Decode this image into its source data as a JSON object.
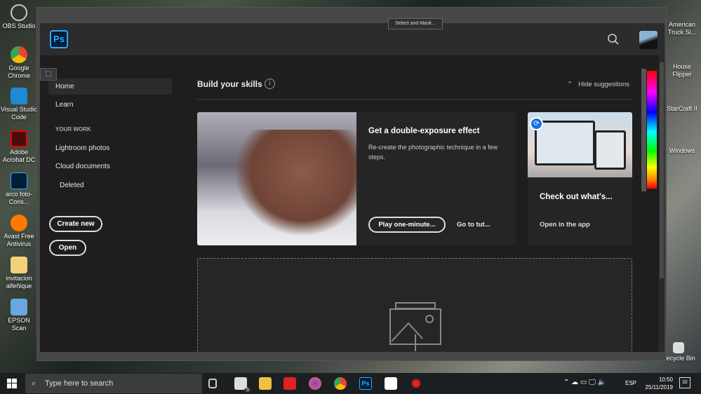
{
  "desktop": {
    "left_icons": [
      "OBS Studio",
      "Google Chrome",
      "Visual Studio Code",
      "Adobe Acrobat DC",
      "arco foto-Cons...",
      "Avast Free Antivirus",
      "invitacion alfeñique",
      "EPSON Scan"
    ],
    "right_icons": [
      "American Truck Si...",
      "House Flipper",
      "StarCraft II",
      "Windows"
    ],
    "recycle_bin": "Recycle Bin"
  },
  "app": {
    "logo": "Ps",
    "select_and_mask": "Select and Mask...",
    "marquee_icon": "⬚",
    "sidebar": {
      "home": "Home",
      "learn": "Learn",
      "section": "YOUR WORK",
      "lightroom": "Lightroom photos",
      "cloud": "Cloud documents",
      "deleted": "Deleted",
      "create_new": "Create new",
      "open": "Open"
    },
    "main": {
      "title": "Build your skills",
      "info": "i",
      "hide": "Hide suggestions",
      "card1": {
        "title": "Get a double-exposure effect",
        "desc": "Re-create the photographic technique in a few steps.",
        "play": "Play one-minute...",
        "goto": "Go to tut..."
      },
      "card2": {
        "title": "Check out what's...",
        "link": "Open in the app"
      }
    }
  },
  "taskbar": {
    "search_placeholder": "Type here to search",
    "mail_badge": "5",
    "ps": "Ps",
    "lang": "ESP",
    "time": "10:50",
    "date": "25/11/2019",
    "notifications": "32"
  },
  "colors": {
    "accent": "#31a8ff",
    "bg": "#1e1e1e"
  }
}
